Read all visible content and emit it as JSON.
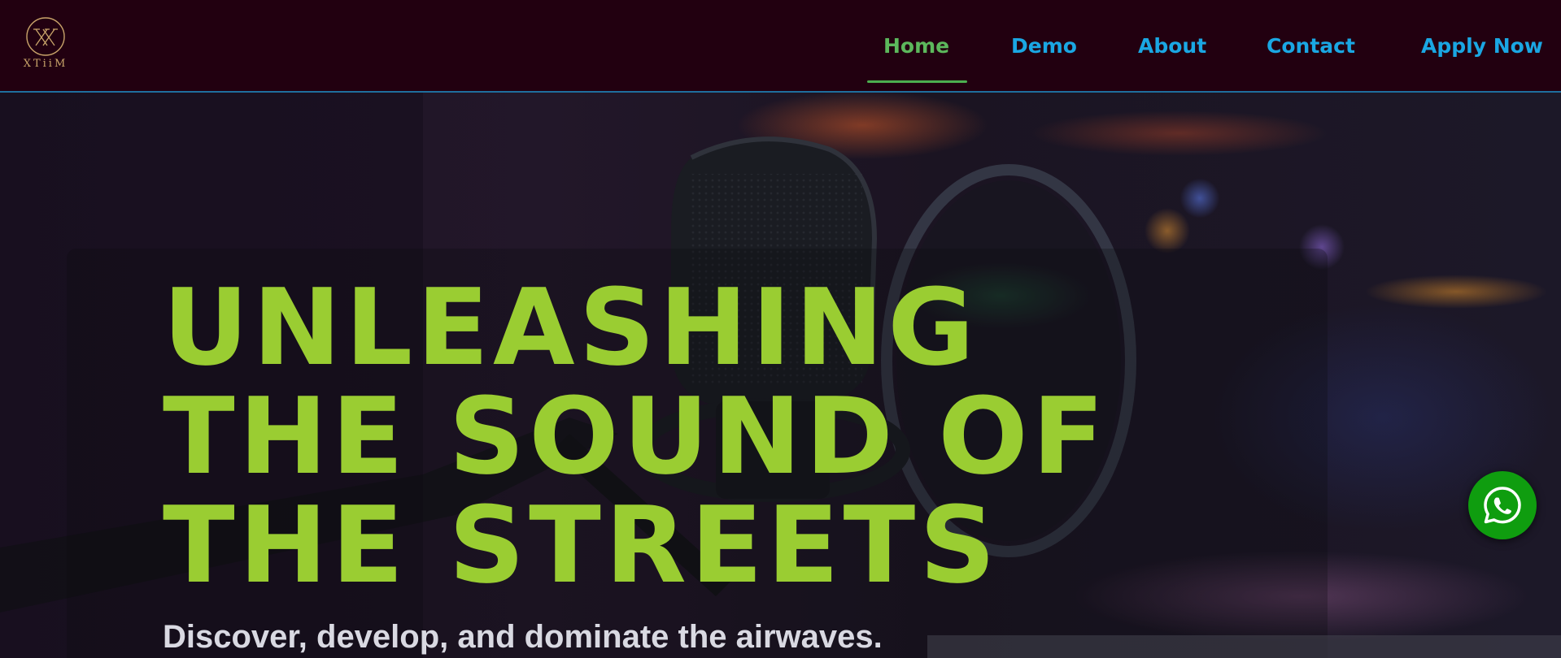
{
  "logo": {
    "text": "XTiiM",
    "icon": "xtiim-monogram-logo"
  },
  "nav": {
    "items": [
      {
        "label": "Home",
        "active": true
      },
      {
        "label": "Demo"
      },
      {
        "label": "About"
      },
      {
        "label": "Contact"
      },
      {
        "label": "Apply Now"
      }
    ]
  },
  "hero": {
    "title_lines": [
      "UNLEASHING",
      "THE SOUND OF",
      "THE STREETS"
    ],
    "subtitle": "Discover, develop, and dominate the airwaves."
  },
  "floating": {
    "icon": "whatsapp-icon"
  },
  "colors": {
    "nav_bg": "#220010",
    "nav_link": "#1aa7e3",
    "nav_active": "#5cb85c",
    "hero_title": "#9acd32",
    "whatsapp": "#0f9d0f"
  }
}
